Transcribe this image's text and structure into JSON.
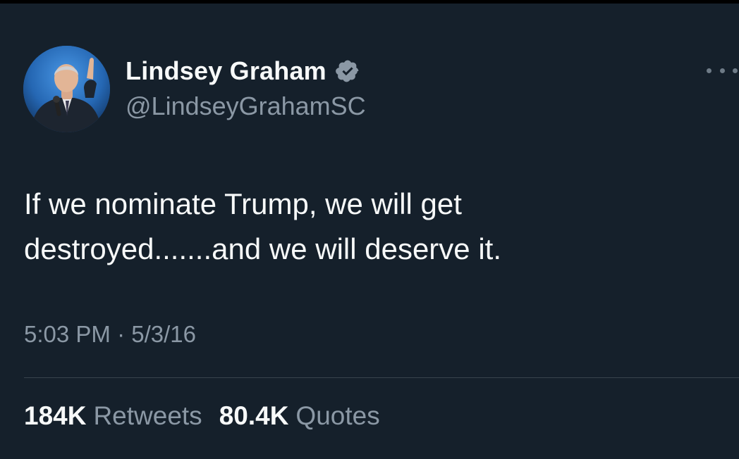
{
  "author": {
    "display_name": "Lindsey Graham",
    "handle": "@LindseyGrahamSC",
    "verified_icon": "verified-badge-icon",
    "avatar_icon": "profile-photo"
  },
  "menu": {
    "icon": "more-options-icon"
  },
  "tweet": {
    "text": "If we nominate Trump, we will get\ndestroyed.......and we will deserve it.",
    "time": "5:03 PM",
    "separator": "·",
    "date": "5/3/16"
  },
  "stats": {
    "retweets_count": "184K",
    "retweets_label": "Retweets",
    "quotes_count": "80.4K",
    "quotes_label": "Quotes"
  },
  "colors": {
    "background": "#15202b",
    "text_primary": "#f7f9f9",
    "text_secondary": "#8b98a5",
    "divider": "#38444d",
    "verified": "#8b98a5"
  }
}
